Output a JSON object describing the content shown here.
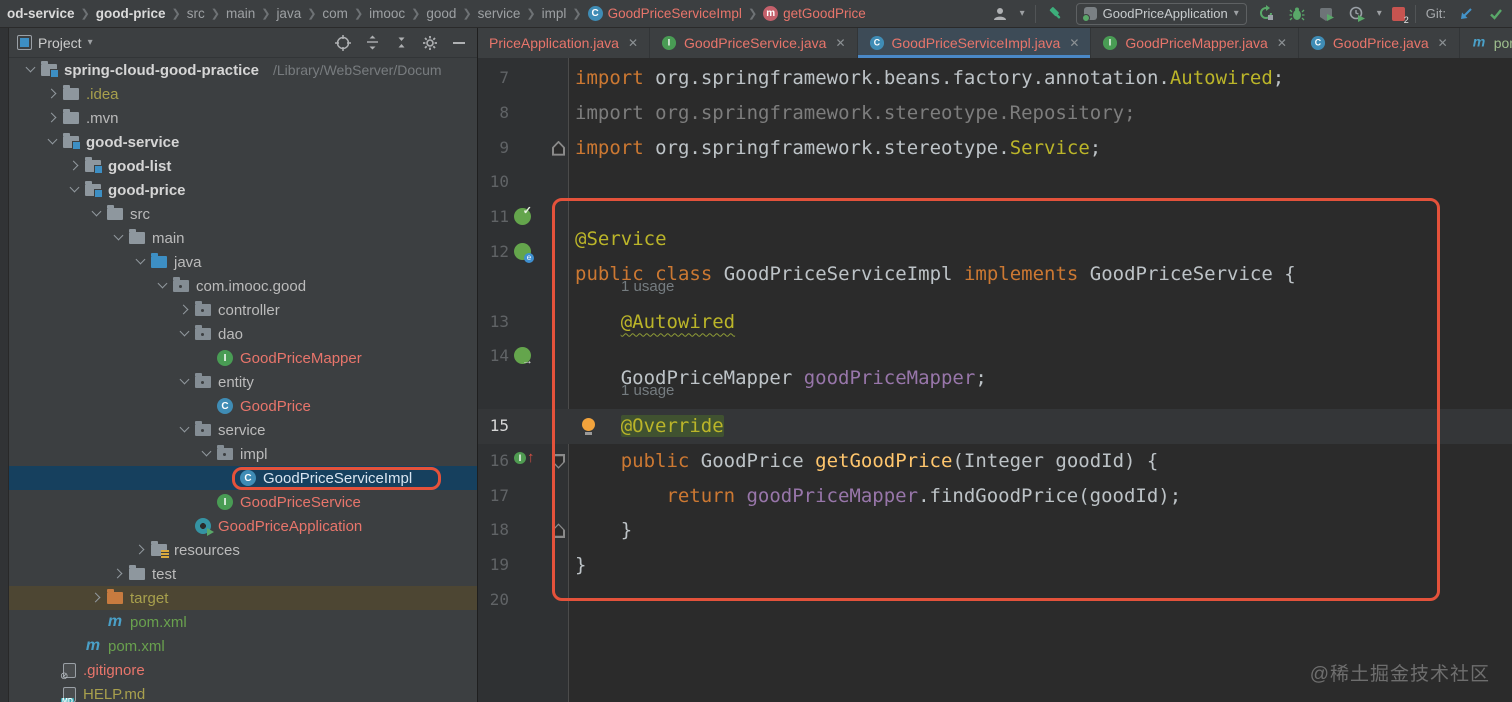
{
  "topbar": {
    "breadcrumbs": [
      {
        "label": "od-service",
        "style": "bold"
      },
      {
        "label": "good-price",
        "style": "bold"
      },
      {
        "label": "src"
      },
      {
        "label": "main"
      },
      {
        "label": "java"
      },
      {
        "label": "com"
      },
      {
        "label": "imooc"
      },
      {
        "label": "good"
      },
      {
        "label": "service"
      },
      {
        "label": "impl"
      },
      {
        "label": "GoodPriceServiceImpl",
        "style": "accent",
        "icon": "class"
      },
      {
        "label": "getGoodPrice",
        "style": "accent",
        "icon": "method"
      }
    ],
    "right": {
      "run_config": "GoodPriceApplication",
      "problems_count": "2",
      "git_label": "Git:",
      "icons": [
        "user-icon",
        "dropdown",
        "build-hammer-icon",
        "run-config-combo",
        "rerun-icon",
        "debug-icon",
        "coverage-icon",
        "profiler-icon",
        "chevron-down-icon",
        "problems-badge",
        "git-update-icon",
        "git-commit-icon"
      ]
    }
  },
  "project_panel": {
    "title": "Project",
    "header_icons": [
      "locate-icon",
      "expand-all-icon",
      "collapse-all-icon",
      "settings-gear-icon",
      "hide-panel-icon"
    ],
    "tree": [
      {
        "level": 0,
        "chevron": "exp",
        "icon": "folder-module",
        "label": "spring-cloud-good-practice",
        "bold": true,
        "suffix": "/Library/WebServer/Docum"
      },
      {
        "level": 1,
        "chevron": "col",
        "icon": "folder",
        "label": ".idea",
        "color": "olive"
      },
      {
        "level": 1,
        "chevron": "col",
        "icon": "folder",
        "label": ".mvn"
      },
      {
        "level": 1,
        "chevron": "exp",
        "icon": "folder-module",
        "label": "good-service",
        "bold": true
      },
      {
        "level": 2,
        "chevron": "col",
        "icon": "folder-module",
        "label": "good-list",
        "bold": true
      },
      {
        "level": 2,
        "chevron": "exp",
        "icon": "folder-module",
        "label": "good-price",
        "bold": true
      },
      {
        "level": 3,
        "chevron": "exp",
        "icon": "folder",
        "label": "src"
      },
      {
        "level": 4,
        "chevron": "exp",
        "icon": "folder",
        "label": "main"
      },
      {
        "level": 5,
        "chevron": "exp",
        "icon": "folder-source",
        "label": "java"
      },
      {
        "level": 6,
        "chevron": "exp",
        "icon": "package",
        "label": "com.imooc.good"
      },
      {
        "level": 7,
        "chevron": "col",
        "icon": "package",
        "label": "controller"
      },
      {
        "level": 7,
        "chevron": "exp",
        "icon": "package",
        "label": "dao"
      },
      {
        "level": 8,
        "chevron": "none",
        "icon": "interface",
        "label": "GoodPriceMapper",
        "color": "salmon"
      },
      {
        "level": 7,
        "chevron": "exp",
        "icon": "package",
        "label": "entity"
      },
      {
        "level": 8,
        "chevron": "none",
        "icon": "class",
        "label": "GoodPrice",
        "color": "salmon"
      },
      {
        "level": 7,
        "chevron": "exp",
        "icon": "package",
        "label": "service"
      },
      {
        "level": 8,
        "chevron": "exp",
        "icon": "package",
        "label": "impl"
      },
      {
        "level": 9,
        "chevron": "none",
        "icon": "class",
        "label": "GoodPriceServiceImpl",
        "color": "white",
        "selected": true,
        "redbox": true
      },
      {
        "level": 8,
        "chevron": "none",
        "icon": "interface",
        "label": "GoodPriceService",
        "color": "salmon"
      },
      {
        "level": 7,
        "chevron": "none",
        "icon": "springboot",
        "label": "GoodPriceApplication",
        "color": "salmon"
      },
      {
        "level": 5,
        "chevron": "col",
        "icon": "folder-resources",
        "label": "resources"
      },
      {
        "level": 4,
        "chevron": "col",
        "icon": "folder",
        "label": "test"
      },
      {
        "level": 3,
        "chevron": "col",
        "icon": "folder-excluded",
        "label": "target",
        "color": "olive",
        "highlighted": true
      },
      {
        "level": 3,
        "chevron": "none",
        "icon": "maven",
        "label": "pom.xml",
        "color": "green"
      },
      {
        "level": 2,
        "chevron": "none",
        "icon": "maven",
        "label": "pom.xml",
        "color": "green"
      },
      {
        "level": 1,
        "chevron": "none",
        "icon": "file-ignored",
        "label": ".gitignore",
        "color": "salmon"
      },
      {
        "level": 1,
        "chevron": "none",
        "icon": "markdown",
        "label": "HELP.md",
        "color": "olive"
      }
    ]
  },
  "editor": {
    "tabs": [
      {
        "label": "PriceApplication.java",
        "icon": "none",
        "closable": true
      },
      {
        "label": "GoodPriceService.java",
        "icon": "interface",
        "closable": true
      },
      {
        "label": "GoodPriceServiceImpl.java",
        "icon": "class",
        "closable": true,
        "active": true
      },
      {
        "label": "GoodPriceMapper.java",
        "icon": "interface",
        "closable": true
      },
      {
        "label": "GoodPrice.java",
        "icon": "class",
        "closable": true
      },
      {
        "label": "pom.xml (",
        "icon": "maven",
        "closable": false,
        "color": "green"
      }
    ],
    "code_lines": [
      {
        "num": "7",
        "indent": 0,
        "segments": [
          {
            "t": "import ",
            "c": "kw"
          },
          {
            "t": "org.springframework.beans.factory.annotation.",
            "c": "pl"
          },
          {
            "t": "Autowired",
            "c": "ann"
          },
          {
            "t": ";",
            "c": "pl"
          }
        ]
      },
      {
        "num": "8",
        "indent": 0,
        "segments": [
          {
            "t": "import org.springframework.stereotype.Repository;",
            "c": "gr"
          }
        ]
      },
      {
        "num": "9",
        "indent": 0,
        "fold": "up",
        "segments": [
          {
            "t": "import ",
            "c": "kw"
          },
          {
            "t": "org.springframework.stereotype.",
            "c": "pl"
          },
          {
            "t": "Service",
            "c": "ann"
          },
          {
            "t": ";",
            "c": "pl"
          }
        ]
      },
      {
        "num": "10",
        "indent": 0,
        "segments": []
      },
      {
        "num": "11",
        "indent": 0,
        "gutter": "bean-check",
        "segments": [
          {
            "t": "@Service",
            "c": "ann"
          }
        ]
      },
      {
        "num": "12",
        "indent": 0,
        "gutter": "bean-endpoint",
        "segments": [
          {
            "t": "public class ",
            "c": "kw"
          },
          {
            "t": "GoodPriceServiceImpl ",
            "c": "pl"
          },
          {
            "t": "implements ",
            "c": "kw"
          },
          {
            "t": "GoodPriceService {",
            "c": "pl"
          }
        ]
      },
      {
        "inlay": "1 usage",
        "indent": 1
      },
      {
        "num": "13",
        "indent": 1,
        "segments": [
          {
            "t": "@Autowired",
            "c": "annw"
          }
        ]
      },
      {
        "num": "14",
        "indent": 1,
        "gutter": "bean-arrow",
        "segments": [
          {
            "t": "GoodPriceMapper ",
            "c": "pl"
          },
          {
            "t": "goodPriceMapper",
            "c": "fld"
          },
          {
            "t": ";",
            "c": "pl"
          }
        ]
      },
      {
        "inlay": "1 usage",
        "indent": 1
      },
      {
        "num": "15",
        "indent": 1,
        "current": true,
        "bulb": true,
        "segments": [
          {
            "t": "@Override",
            "c": "annh"
          }
        ]
      },
      {
        "num": "16",
        "indent": 1,
        "gutter": "implements",
        "fold": "down",
        "segments": [
          {
            "t": "public ",
            "c": "kw"
          },
          {
            "t": "GoodPrice ",
            "c": "pl"
          },
          {
            "t": "getGoodPrice",
            "c": "mth"
          },
          {
            "t": "(Integer goodId) {",
            "c": "pl"
          }
        ]
      },
      {
        "num": "17",
        "indent": 2,
        "segments": [
          {
            "t": "return ",
            "c": "kw"
          },
          {
            "t": "goodPriceMapper",
            "c": "fld"
          },
          {
            "t": ".findGoodPrice(goodId);",
            "c": "pl"
          }
        ]
      },
      {
        "num": "18",
        "indent": 1,
        "fold": "up",
        "segments": [
          {
            "t": "}",
            "c": "pl"
          }
        ]
      },
      {
        "num": "19",
        "indent": 0,
        "segments": [
          {
            "t": "}",
            "c": "pl"
          }
        ]
      },
      {
        "num": "20",
        "indent": 0,
        "segments": []
      }
    ]
  },
  "watermark": "@稀土掘金技术社区",
  "colors": {
    "annotation_red": "#E4523B",
    "selection_blue": "#16405E",
    "active_tab_underline": "#4A88C7",
    "keyword_orange": "#CC7832",
    "annotation_yellow": "#BBB529",
    "field_purple": "#9876AA",
    "method_yellow": "#FFC66D",
    "file_salmon": "#E8756B",
    "file_green": "#69A14E",
    "excluded_olive": "#A8A04D"
  }
}
